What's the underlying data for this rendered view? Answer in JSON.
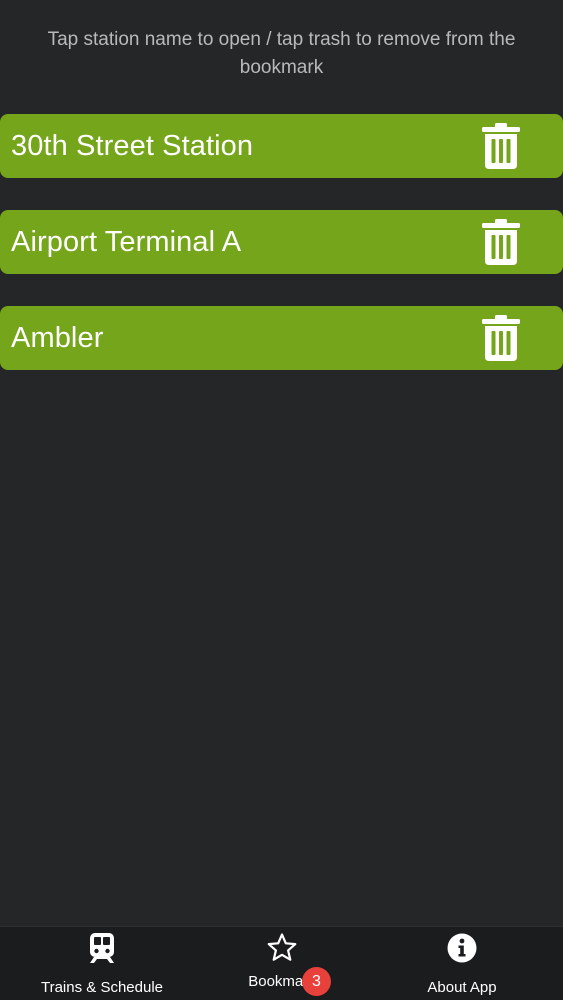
{
  "instructions": "Tap station name to open / tap trash to remove from the bookmark",
  "colors": {
    "background": "#252628",
    "item_background": "#74a51b",
    "tab_bar_background": "#1b1c1e",
    "badge": "#e8403a"
  },
  "bookmarks": [
    {
      "name": "30th Street Station",
      "icon": "trash-icon"
    },
    {
      "name": "Airport Terminal A",
      "icon": "trash-icon"
    },
    {
      "name": "Ambler",
      "icon": "trash-icon"
    }
  ],
  "tabs": {
    "trains": {
      "label": "Trains & Schedule",
      "icon": "train-icon"
    },
    "bookmarks": {
      "label": "Bookmark",
      "icon": "star-icon",
      "badge": "3"
    },
    "about": {
      "label": "About App",
      "icon": "info-icon"
    }
  }
}
